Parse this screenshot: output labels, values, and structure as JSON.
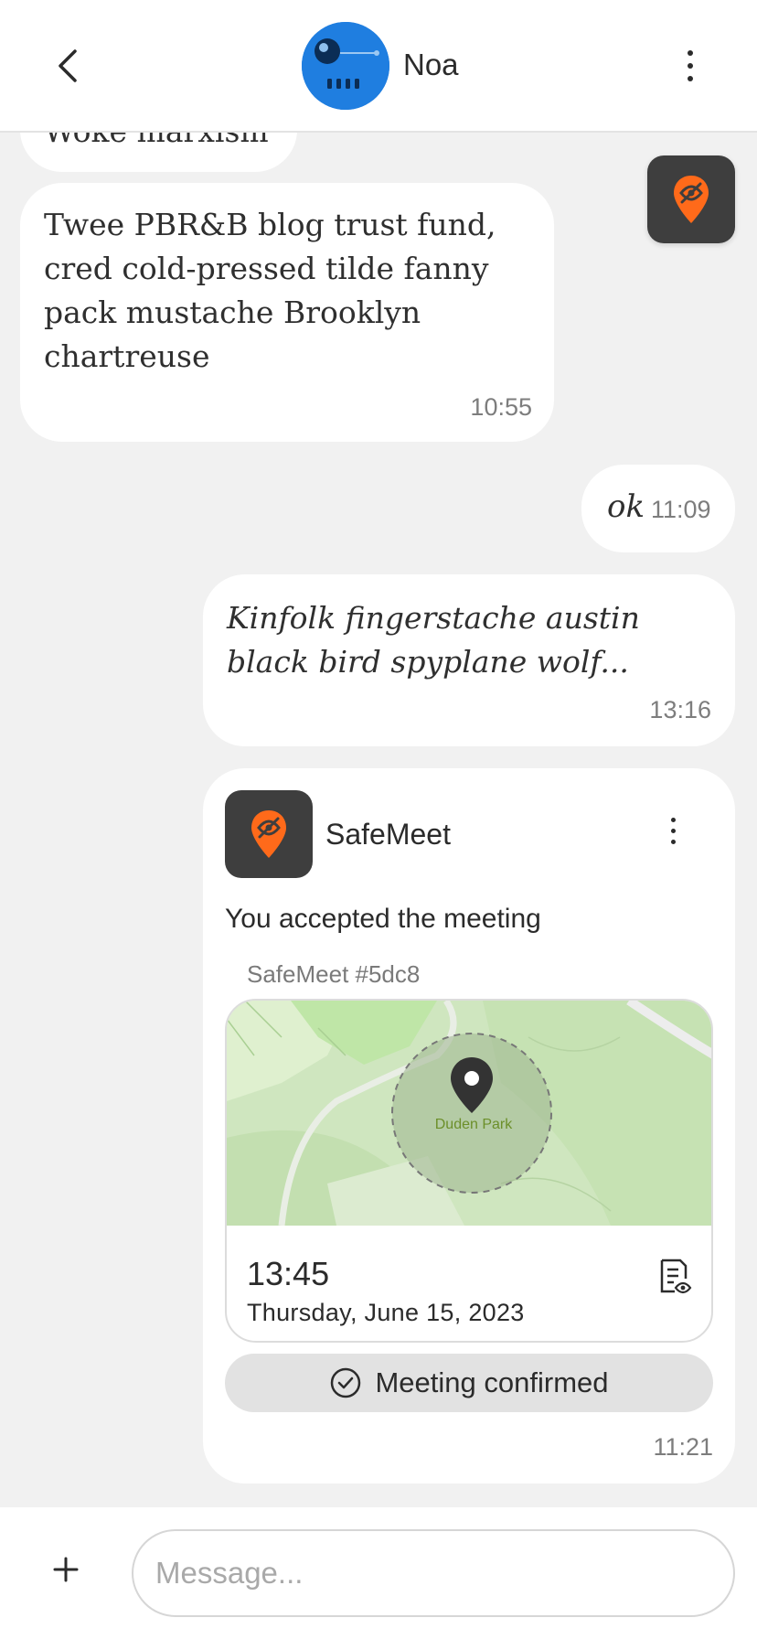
{
  "header": {
    "contact_name": "Noa",
    "back_icon": "chevron-left-icon",
    "menu_icon": "more-vertical-icon"
  },
  "messages": [
    {
      "id": "m0",
      "direction": "incoming",
      "text": "Woke marxism",
      "time": ""
    },
    {
      "id": "m1",
      "direction": "incoming",
      "text": "Twee PBR&B blog trust fund, cred cold-pressed tilde fanny pack mustache Brooklyn chartreuse",
      "time": "10:55"
    },
    {
      "id": "m2",
      "direction": "outgoing",
      "text": "ok",
      "time": "11:09"
    },
    {
      "id": "m3",
      "direction": "outgoing",
      "text": "Kinfolk fingerstache austin black bird spyplane wolf...",
      "time": "13:16"
    }
  ],
  "meeting": {
    "app_name": "SafeMeet",
    "status_text": "You accepted the meeting",
    "meeting_id": "SafeMeet #5dc8",
    "place_label": "Duden Park",
    "time": "13:45",
    "date": "Thursday, June 15, 2023",
    "confirmed_label": "Meeting confirmed",
    "message_time": "11:21"
  },
  "composer": {
    "placeholder": "Message..."
  },
  "colors": {
    "accent": "#ff6a1a",
    "tile_dark": "#3e3e3e",
    "avatar_blue": "#1f7ee0",
    "chat_background": "#f1f1f1"
  }
}
